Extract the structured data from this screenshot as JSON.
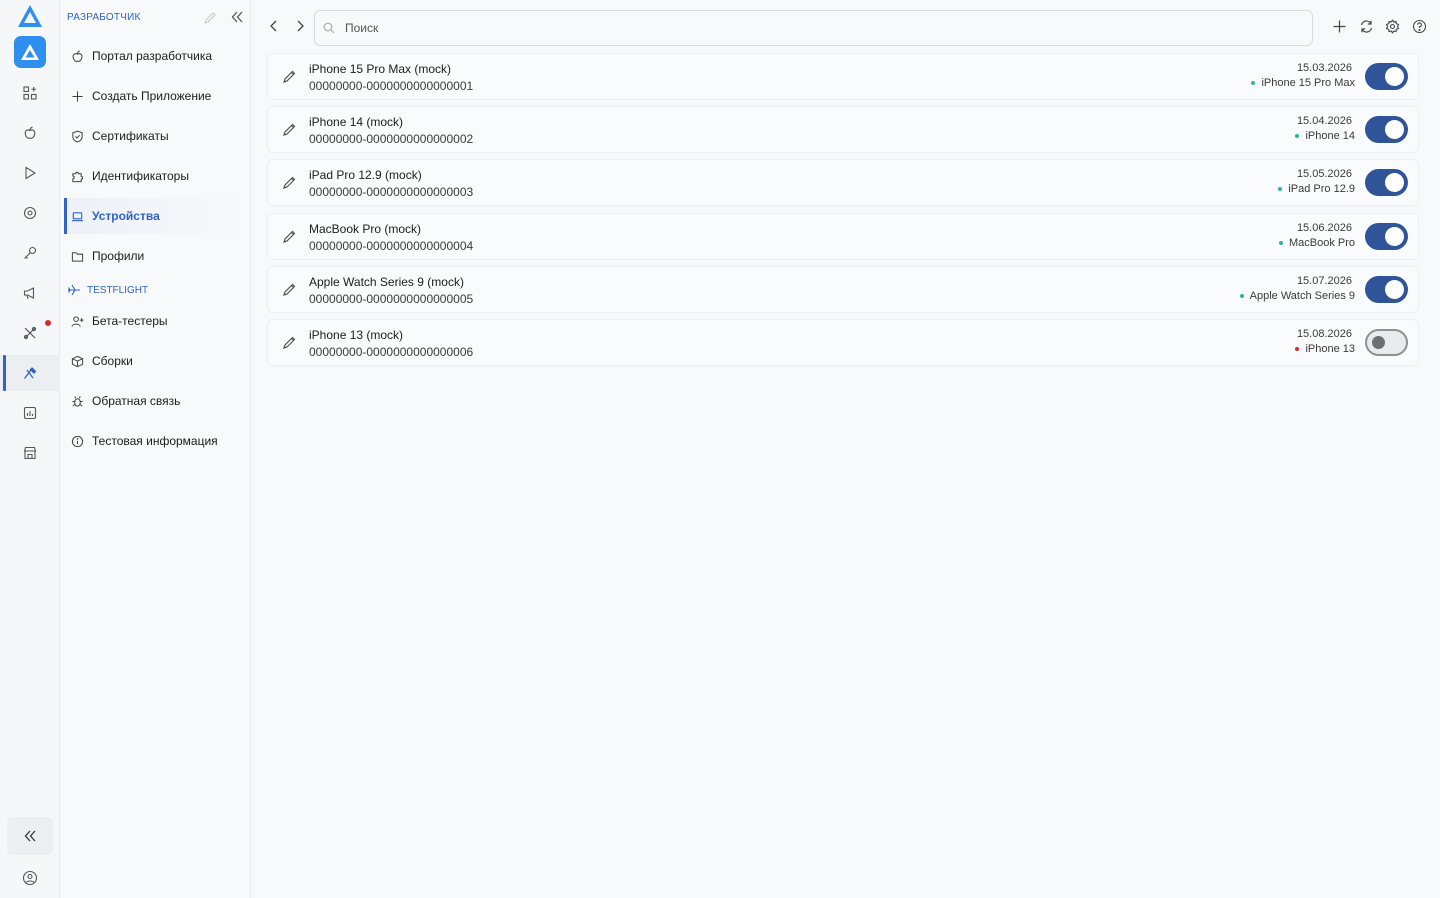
{
  "sidebar": {
    "header": "РАЗРАБОТЧИК",
    "items": [
      {
        "label": "Портал разработчика",
        "icon": "apple-icon"
      },
      {
        "label": "Создать Приложение",
        "icon": "plus-icon"
      },
      {
        "label": "Сертификаты",
        "icon": "shield-check-icon"
      },
      {
        "label": "Идентификаторы",
        "icon": "puzzle-icon"
      },
      {
        "label": "Устройства",
        "icon": "laptop-icon",
        "active": true
      },
      {
        "label": "Профили",
        "icon": "folder-icon"
      }
    ],
    "section_testflight": "TESTFLIGHT",
    "testflight_items": [
      {
        "label": "Бета-тестеры",
        "icon": "user-plus-icon"
      },
      {
        "label": "Сборки",
        "icon": "box-icon"
      },
      {
        "label": "Обратная связь",
        "icon": "bug-icon"
      },
      {
        "label": "Тестовая информация",
        "icon": "info-icon"
      }
    ]
  },
  "toolbar": {
    "search_placeholder": "Поиск"
  },
  "devices": [
    {
      "name": "iPhone 15 Pro Max (mock)",
      "udid": "00000000-0000000000000001",
      "date": "15.03.2026",
      "model": "iPhone 15 Pro Max",
      "enabled": true
    },
    {
      "name": "iPhone 14 (mock)",
      "udid": "00000000-0000000000000002",
      "date": "15.04.2026",
      "model": "iPhone 14",
      "enabled": true
    },
    {
      "name": "iPad Pro 12.9 (mock)",
      "udid": "00000000-0000000000000003",
      "date": "15.05.2026",
      "model": "iPad Pro 12.9",
      "enabled": true
    },
    {
      "name": "MacBook Pro (mock)",
      "udid": "00000000-0000000000000004",
      "date": "15.06.2026",
      "model": "MacBook Pro",
      "enabled": true
    },
    {
      "name": "Apple Watch Series 9 (mock)",
      "udid": "00000000-0000000000000005",
      "date": "15.07.2026",
      "model": "Apple Watch Series 9",
      "enabled": true
    },
    {
      "name": "iPhone 13 (mock)",
      "udid": "00000000-0000000000000006",
      "date": "15.08.2026",
      "model": "iPhone 13",
      "enabled": false
    }
  ],
  "colors": {
    "accent": "#2f63c7",
    "toggle_on": "#2f5498",
    "status_active": "#2bb3a3",
    "status_inactive": "#d92a2a",
    "rail_badge": "#d92a2a"
  }
}
